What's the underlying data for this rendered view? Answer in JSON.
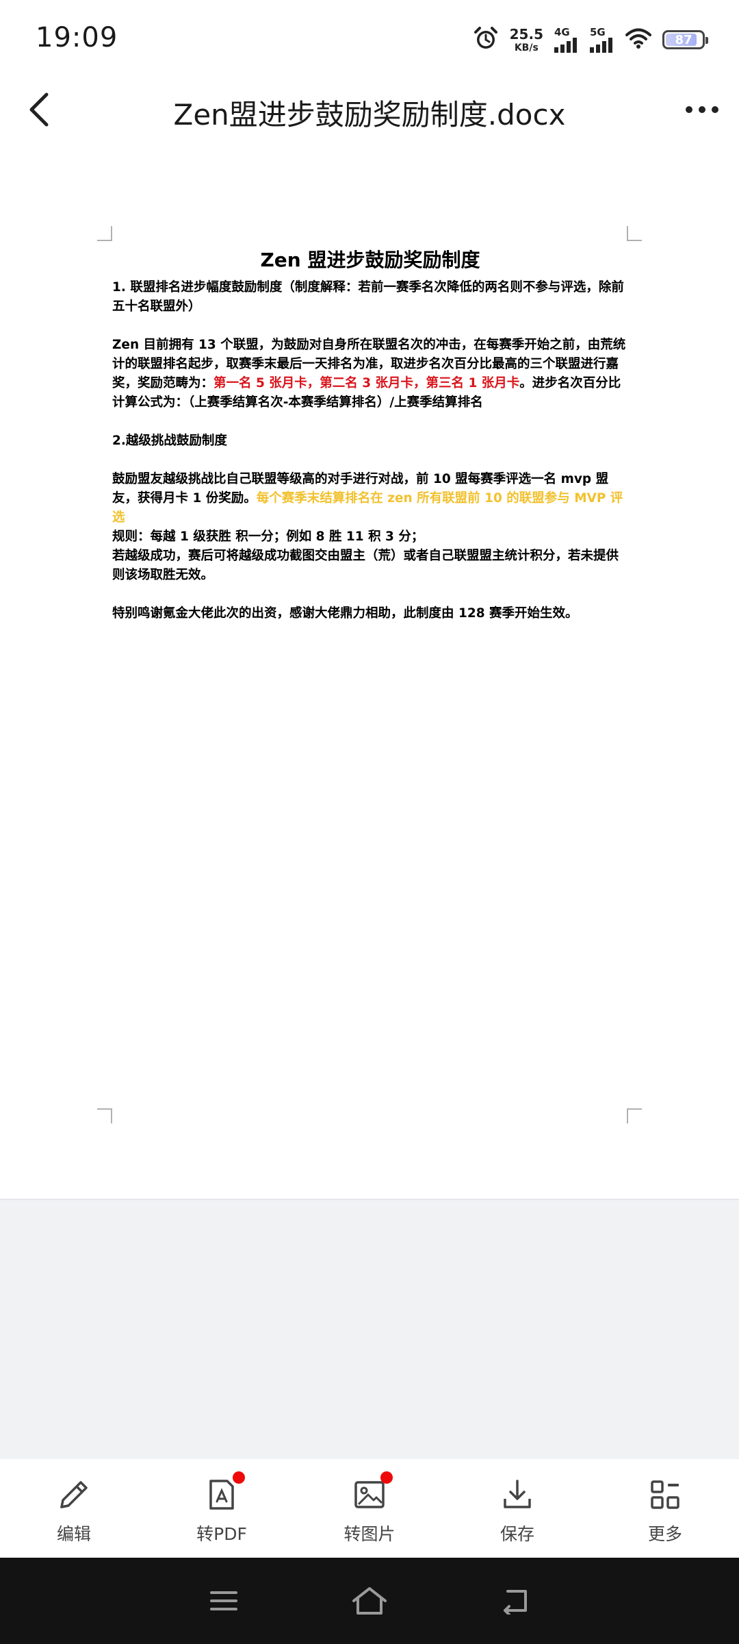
{
  "status_bar": {
    "time": "19:09",
    "net_speed_value": "25.5",
    "net_speed_unit": "KB/s",
    "signal_1_label": "4G",
    "signal_2_label": "5G",
    "battery_level": "87"
  },
  "header": {
    "title": "Zen盟进步鼓励奖励制度.docx"
  },
  "document": {
    "heading": "Zen 盟进步鼓励奖励制度",
    "section1_title": "1. 联盟排名进步幅度鼓励制度（制度解释：若前一赛季名次降低的两名则不参与评选，除前五十名联盟外）",
    "section1_body_pre": "Zen 目前拥有 13 个联盟，为鼓励对自身所在联盟名次的冲击，在每赛季开始之前，由荒统计的联盟排名起步，取赛季末最后一天排名为准，取进步名次百分比最高的三个联盟进行嘉奖，奖励范畴为：",
    "section1_body_highlight": "第一名 5 张月卡，第二名 3 张月卡，第三名 1 张月卡",
    "section1_body_post": "。进步名次百分比计算公式为：（上赛季结算名次-本赛季结算排名）/上赛季结算排名",
    "section2_title": "2.越级挑战鼓励制度",
    "section2_body_pre": "鼓励盟友越级挑战比自己联盟等级高的对手进行对战，前 10 盟每赛季评选一名 mvp 盟友，获得月卡 1 份奖励。",
    "section2_body_highlight": "每个赛季末结算排名在 zen 所有联盟前 10 的联盟参与 MVP 评选",
    "rule_line": "规则：每越 1 级获胜 积一分；例如 8 胜 11 积 3 分；",
    "rule_line2": "若越级成功，赛后可将越级成功截图交由盟主（荒）或者自己联盟盟主统计积分，若未提供则该场取胜无效。",
    "thanks": "特别鸣谢氪金大佬此次的出资，感谢大佬鼎力相助，此制度由 128 赛季开始生效。"
  },
  "toolbar": {
    "items": [
      {
        "label": "编辑",
        "icon": "pencil-icon"
      },
      {
        "label": "转PDF",
        "icon": "pdf-icon"
      },
      {
        "label": "转图片",
        "icon": "image-icon"
      },
      {
        "label": "保存",
        "icon": "download-icon"
      },
      {
        "label": "更多",
        "icon": "grid-icon"
      }
    ]
  },
  "colors": {
    "highlight_red": "#d9141b",
    "highlight_yellow": "#f2c12e",
    "notification_dot": "#ee0a0a"
  }
}
